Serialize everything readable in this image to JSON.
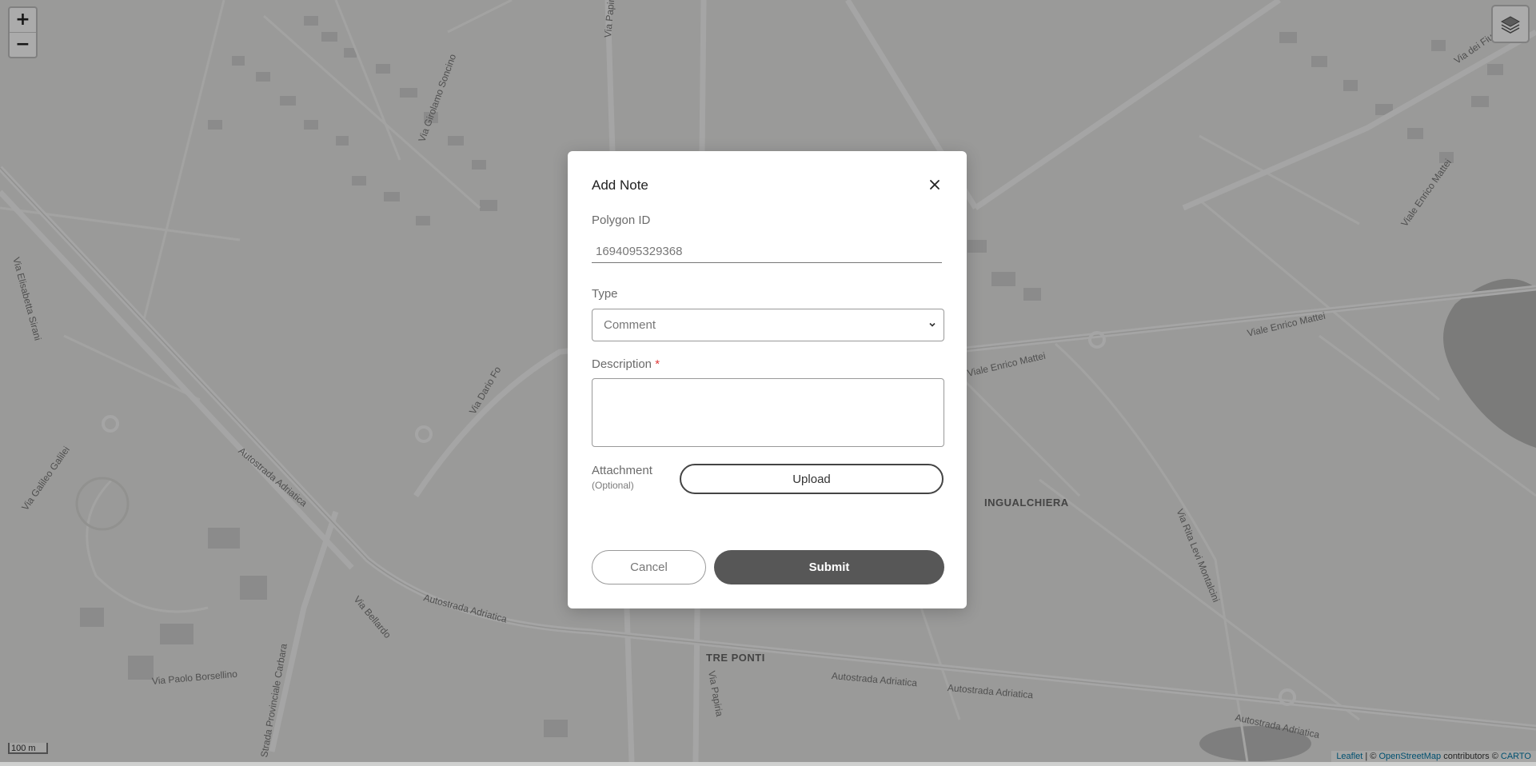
{
  "map": {
    "labels": [
      {
        "text": "Via Girolamo Soncino"
      },
      {
        "text": "Via Paolo Borsellino"
      },
      {
        "text": "Via Dario Fo"
      },
      {
        "text": "Via Elisabetta Sirani"
      },
      {
        "text": "Via Galileo Galilei"
      },
      {
        "text": "Autostrada Adriatica"
      },
      {
        "text": "Autostrada Adriatica"
      },
      {
        "text": "Autostrada Adriatica"
      },
      {
        "text": "Autostrada Adriatica"
      },
      {
        "text": "Autostrada Adriatica"
      },
      {
        "text": "Viale Enrico Mattei"
      },
      {
        "text": "Viale Enrico Mattei"
      },
      {
        "text": "Viale Enrico Mattei"
      },
      {
        "text": "Via Rita Levi Montalcini"
      },
      {
        "text": "Via Papiria"
      },
      {
        "text": "Via Papiria"
      },
      {
        "text": "Strada Provinciale Carbara"
      },
      {
        "text": "Via Bellardo"
      },
      {
        "text": "Via dei Fiume"
      },
      {
        "text": "INGUALCHIERA",
        "place": true
      },
      {
        "text": "TRE PONTI",
        "place": true
      }
    ],
    "scale": "100 m",
    "attribution": {
      "leaflet": "Leaflet",
      "sep": " | © ",
      "osm": "OpenStreetMap",
      "contrib": " contributors © ",
      "carto": "CARTO"
    }
  },
  "zoom": {
    "in": "+",
    "out": "−"
  },
  "modal": {
    "title": "Add Note",
    "polygon_label": "Polygon ID",
    "polygon_value": "1694095329368",
    "type_label": "Type",
    "type_selected": "Comment",
    "description_label": "Description",
    "required_mark": "*",
    "attachment_label": "Attachment",
    "attachment_sub": "(Optional)",
    "upload_label": "Upload",
    "cancel_label": "Cancel",
    "submit_label": "Submit"
  }
}
